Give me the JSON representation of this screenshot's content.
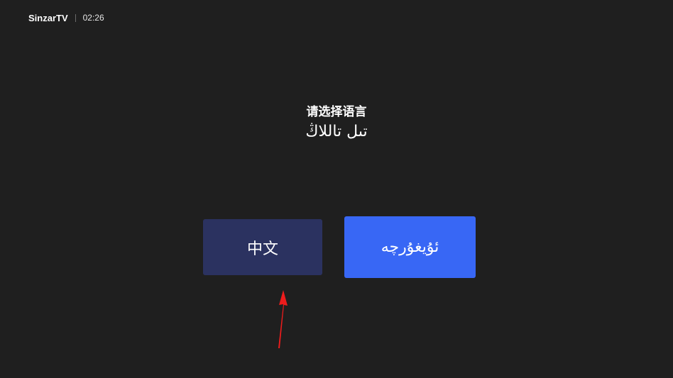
{
  "status_bar": {
    "brand": "SinzarTV",
    "time": "02:26"
  },
  "prompt": {
    "chinese": "请选择语言",
    "uyghur": "تىل تاللاڭ"
  },
  "language_options": [
    {
      "label": "中文",
      "selected": true
    },
    {
      "label": "ئۇيغۇرچە",
      "selected": false
    }
  ],
  "colors": {
    "background": "#1f1f1f",
    "selected_button": "#2b3260",
    "accent_button": "#3867f5",
    "annotation_arrow": "#ee1c1c"
  },
  "annotation": {
    "icon": "red-arrow-up-icon"
  }
}
